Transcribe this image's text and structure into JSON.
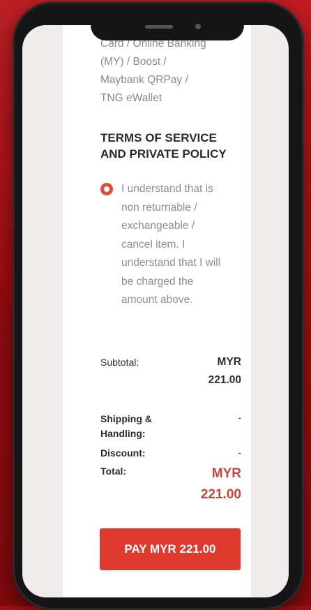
{
  "payment": {
    "methods_lines": [
      "Card / Online Banking",
      "(MY) / Boost /",
      "Maybank QRPay /",
      "TNG eWallet"
    ]
  },
  "terms": {
    "heading_line1": "TERMS OF SERVICE",
    "heading_line2": "AND PRIVATE POLICY",
    "agreement_lines": [
      "I understand that is",
      "non returnable /",
      "exchangeable /",
      "cancel item. I",
      "understand that I will",
      "be charged the",
      "amount above."
    ]
  },
  "summary": {
    "subtotal_label": "Subtotal:",
    "subtotal_currency": "MYR",
    "subtotal_amount": "221.00",
    "shipping_label_line1": "Shipping &",
    "shipping_label_line2": "Handling:",
    "shipping_value": "-",
    "discount_label": "Discount:",
    "discount_value": "-",
    "total_label": "Total:",
    "total_currency": "MYR",
    "total_amount": "221.00"
  },
  "actions": {
    "pay_label": "PAY MYR 221.00"
  },
  "colors": {
    "accent": "#e03a2e",
    "total_text": "#c9443a",
    "background": "#a80f12"
  }
}
